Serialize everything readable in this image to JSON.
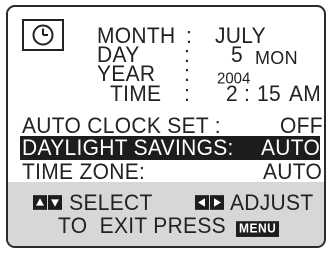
{
  "screen": {
    "clock_icon": "clock-icon",
    "month_label": "MONTH",
    "month_value": "JULY",
    "day_label": "DAY",
    "day_value": "5",
    "weekday": "MON",
    "year_label": "YEAR",
    "year_value": "2004",
    "time_label": "TIME",
    "time_hour": "2",
    "time_minute": "15",
    "time_ampm": "AM",
    "separator": ":",
    "auto_clock_label": "AUTO CLOCK SET :",
    "auto_clock_value": "OFF",
    "daylight_label": "DAYLIGHT SAVINGS:",
    "daylight_value": "AUTO",
    "timezone_label": "TIME ZONE:",
    "timezone_value": "AUTO"
  },
  "footer": {
    "select_label": "SELECT",
    "adjust_label": "ADJUST",
    "exit_text": "TO  EXIT PRESS",
    "menu_key": "MENU",
    "icons": [
      "up-arrow-icon",
      "down-arrow-icon",
      "left-arrow-icon",
      "right-arrow-icon"
    ]
  },
  "colors": {
    "highlight_bg": "#1d1d1d",
    "footer_bg": "#d7d7d7",
    "text": "#222222"
  }
}
